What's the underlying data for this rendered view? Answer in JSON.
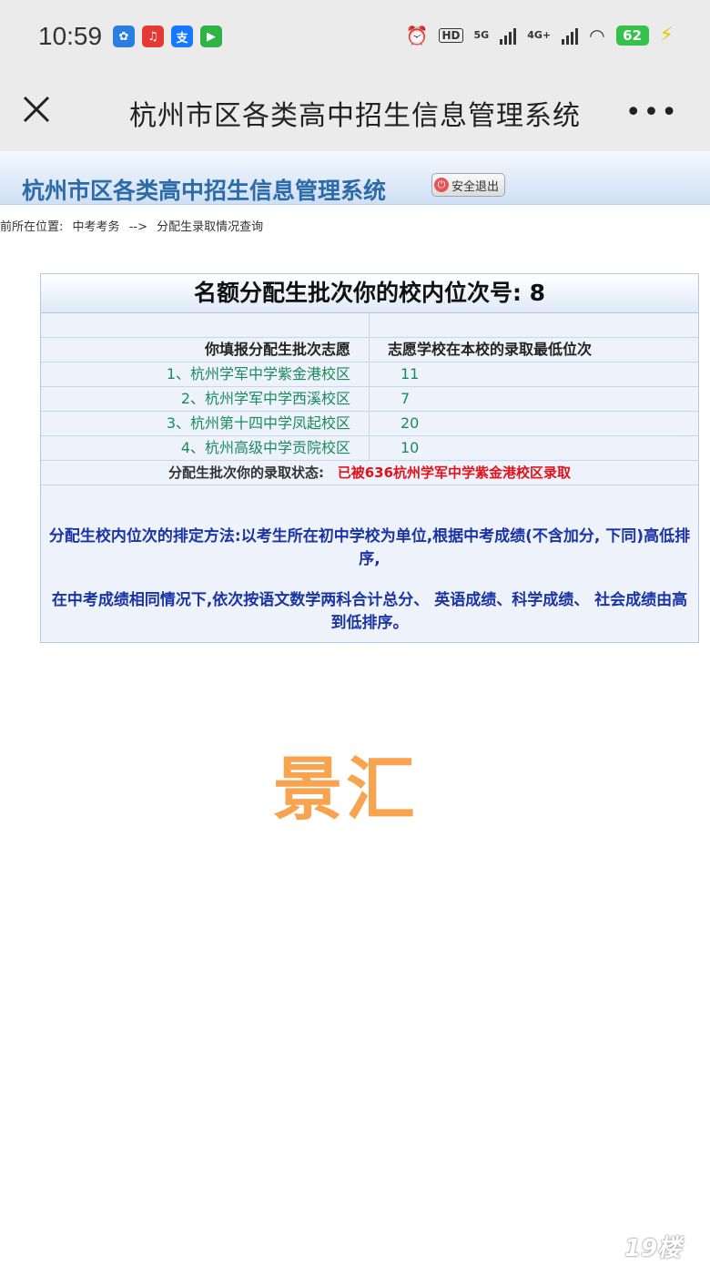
{
  "status_bar": {
    "time": "10:59",
    "apps": [
      {
        "icon": "app-icon-blue",
        "color": "#2a7de1",
        "glyph": "支"
      },
      {
        "icon": "music-app-icon",
        "color": "#e53935",
        "glyph": "♫"
      },
      {
        "icon": "alipay-icon",
        "color": "#1677ff",
        "glyph": "支"
      },
      {
        "icon": "video-app-icon",
        "color": "#2fb344",
        "glyph": "▶"
      }
    ],
    "hd_label": "HD",
    "net_5g": "5G",
    "net_4g": "4G+",
    "battery": "62"
  },
  "nav": {
    "title": "杭州市区各类高中招生信息管理系统",
    "more": "•••"
  },
  "header": {
    "title": "杭州市区各类高中招生信息管理系统",
    "logout_label": "安全退出"
  },
  "breadcrumb": {
    "prefix": "前所在位置:",
    "path_1": "中考考务",
    "arrow": "-->",
    "path_2": "分配生录取情况查询"
  },
  "result": {
    "title": "名额分配生批次你的校内位次号: 8",
    "col_choice": "你填报分配生批次志愿",
    "col_min_rank": "志愿学校在本校的录取最低位次",
    "choices": [
      {
        "school": "1、杭州学军中学紫金港校区",
        "rank": "11"
      },
      {
        "school": "2、杭州学军中学西溪校区",
        "rank": "7"
      },
      {
        "school": "3、杭州第十四中学凤起校区",
        "rank": "20"
      },
      {
        "school": "4、杭州高级中学贡院校区",
        "rank": "10"
      }
    ],
    "status_label": "分配生批次你的录取状态:",
    "status_value": "已被636杭州学军中学紫金港校区录取",
    "note_1": "分配生校内位次的排定方法:以考生所在初中学校为单位,根据中考成绩(不含加分, 下同)高低排序,",
    "note_2": "在中考成绩相同情况下,依次按语文数学两科合计总分、 英语成绩、科学成绩、 社会成绩由高到低排序。"
  },
  "watermark": "景汇",
  "corner_logo": "19楼"
}
